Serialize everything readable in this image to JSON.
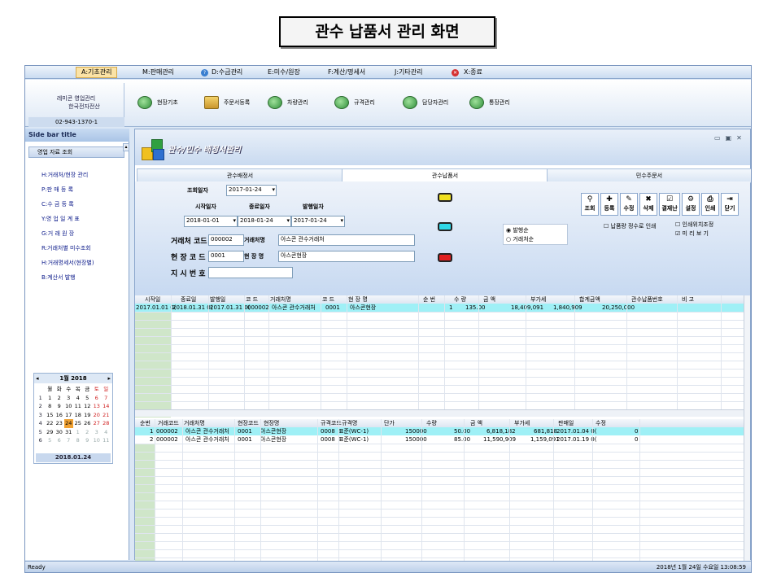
{
  "slide_title": "관수 납품서 관리 화면",
  "menu": [
    {
      "label": "A:기초관리",
      "active": true
    },
    {
      "label": "M:판매관리"
    },
    {
      "label": "D:수금관리"
    },
    {
      "label": "E:미수/원장"
    },
    {
      "label": "F:계산/명세서"
    },
    {
      "label": "J:기타관리"
    },
    {
      "label": "X:종료"
    }
  ],
  "company": {
    "name": "레미콘 영업관리",
    "sub": "한국전자전산",
    "phone": "02-943-1370-1"
  },
  "toolbar": [
    "현장기초",
    "주문서등록",
    "차량관리",
    "규격관리",
    "담당자관리",
    "통장관리"
  ],
  "sidebar": {
    "title": "Side bar title",
    "group": "영업 자료 조회",
    "items": [
      "H:거래처/현장 관리",
      "P:판 매 등 록",
      "C:수 금 등 록",
      "Y:영 업 일 계 표",
      "G:거 래 원 장",
      "R:거래처별 미수조회",
      "H:거래명세서(현장별)",
      "B:계산서 발행"
    ],
    "calendar": {
      "month": "1월 2018",
      "weekdays": [
        "월",
        "화",
        "수",
        "목",
        "금",
        "토",
        "일"
      ],
      "weeks": [
        [
          "1",
          "1",
          "2",
          "3",
          "4",
          "5",
          "6",
          "7"
        ],
        [
          "2",
          "8",
          "9",
          "10",
          "11",
          "12",
          "13",
          "14"
        ],
        [
          "3",
          "15",
          "16",
          "17",
          "18",
          "19",
          "20",
          "21"
        ],
        [
          "4",
          "22",
          "23",
          "24",
          "25",
          "26",
          "27",
          "28"
        ],
        [
          "5",
          "29",
          "30",
          "31",
          "1",
          "2",
          "3",
          "4"
        ],
        [
          "6",
          "5",
          "6",
          "7",
          "8",
          "9",
          "10",
          "11"
        ]
      ],
      "today": "2018.01.24"
    }
  },
  "main": {
    "title": "관수/민수 배정서관리",
    "tabs": [
      "관수배정서",
      "관수납품서",
      "민수주문서"
    ],
    "form": {
      "inquiry_date_label": "조회일자",
      "inquiry_date": "2017-01-24",
      "start_label": "시작일자",
      "start": "2018-01-01",
      "end_label": "종료일자",
      "end": "2018-01-24",
      "issue_label": "발행일자",
      "issue": "2017-01-24",
      "client_code_label": "거래처 코드",
      "client_code": "000002",
      "client_name_label": "거래처명",
      "client_name": "아스콘 관수거래처",
      "site_code_label": "현 장 코 드",
      "site_code": "0001",
      "site_name_label": "현 장 명",
      "site_name": "아스콘현장",
      "order_no_label": "지 시 번 호",
      "order_no": "",
      "radio1": "발행순",
      "radio2": "거래처순",
      "check1": "납품량 정수로 인쇄",
      "check2": "인쇄위치조정",
      "check3": "미 리 보 기"
    },
    "buttons": [
      "조회",
      "등록",
      "수정",
      "삭제",
      "결재난",
      "설정",
      "인쇄",
      "닫기"
    ],
    "grid1": {
      "headers": [
        "시작일",
        "종료일",
        "발행일",
        "코 드",
        "거래처명",
        "코 드",
        "현 장 명",
        "순 번",
        "수 량",
        "금 액",
        "부가세",
        "합계금액",
        "관수납품번호",
        "비 고"
      ],
      "rows": [
        [
          "2017.01.01 0(",
          "2018.01.31 0(",
          "2017.01.31 0(",
          "000002",
          "아스콘 관수거래처",
          "0001",
          "아스콘현장",
          "1",
          "135.00",
          "18,409,091",
          "1,840,909",
          "20,250,000",
          "",
          ""
        ]
      ]
    },
    "grid2": {
      "headers": [
        "순번",
        "거래코드",
        "거래처명",
        "현장코드",
        "현장명",
        "규격코드",
        "규격명",
        "단가",
        "수량",
        "금 액",
        "부가세",
        "판매일",
        "수정"
      ],
      "rows": [
        [
          "1",
          "000002",
          "아스콘 관수거래처",
          "0001",
          "아스콘현장",
          "0008",
          "표준(WC-1)",
          "150000",
          "50.00",
          "6,818,182",
          "681,818",
          "2017.01.04 0(",
          "0"
        ],
        [
          "2",
          "000002",
          "아스콘 관수거래처",
          "0001",
          "아스콘현장",
          "0008",
          "표준(WC-1)",
          "150000",
          "85.00",
          "11,590,909",
          "1,159,091",
          "2017.01.19 0(",
          "0"
        ]
      ]
    }
  },
  "status": {
    "left": "Ready",
    "right": "2018년 1월 24일 수요일 13:08:59"
  },
  "colors": {
    "accent": "#fbe3a6",
    "highlight_row": "#9ff0f6",
    "panel": "#c7d9f1"
  }
}
